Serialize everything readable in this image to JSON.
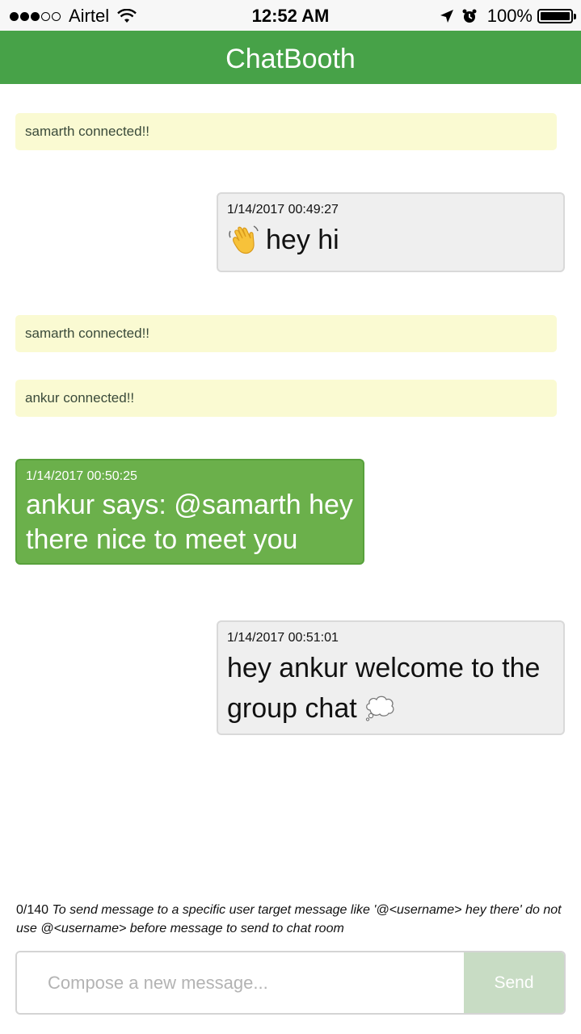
{
  "status_bar": {
    "carrier": "Airtel",
    "time": "12:52 AM",
    "battery": "100%",
    "battery_level": 1.0,
    "signal_bars": 3,
    "signal_max": 5,
    "icons": [
      "signal-dots-icon",
      "wifi-icon",
      "location-arrow-icon",
      "alarm-clock-icon",
      "battery-icon"
    ]
  },
  "header": {
    "title": "ChatBooth",
    "color": "#47a248"
  },
  "messages": [
    {
      "type": "system",
      "text": "samarth connected!!"
    },
    {
      "type": "outgoing",
      "timestamp": "1/14/2017 00:49:27",
      "text": "hey hi",
      "emoji": "waving-hand-icon"
    },
    {
      "type": "system",
      "text": "samarth connected!!"
    },
    {
      "type": "system",
      "text": "ankur connected!!"
    },
    {
      "type": "incoming",
      "timestamp": "1/14/2017 00:50:25",
      "text": "ankur says: @samarth hey there nice to meet you"
    },
    {
      "type": "outgoing",
      "timestamp": "1/14/2017 00:51:01",
      "text": "hey ankur welcome to the group chat",
      "emoji": "thought-bubble-icon"
    }
  ],
  "compose": {
    "counter": "0/140",
    "hint": "To send message to a specific user target message like '@<username> hey there' do not use @<username> before message to send to chat room",
    "placeholder": "Compose a new message...",
    "value": "",
    "send_label": "Send"
  },
  "colors": {
    "accent": "#47a248",
    "incoming_bubble": "#6bb04b",
    "outgoing_bubble": "#efefef",
    "system_bg": "#fafad2",
    "send_disabled": "#c8dcc4"
  }
}
